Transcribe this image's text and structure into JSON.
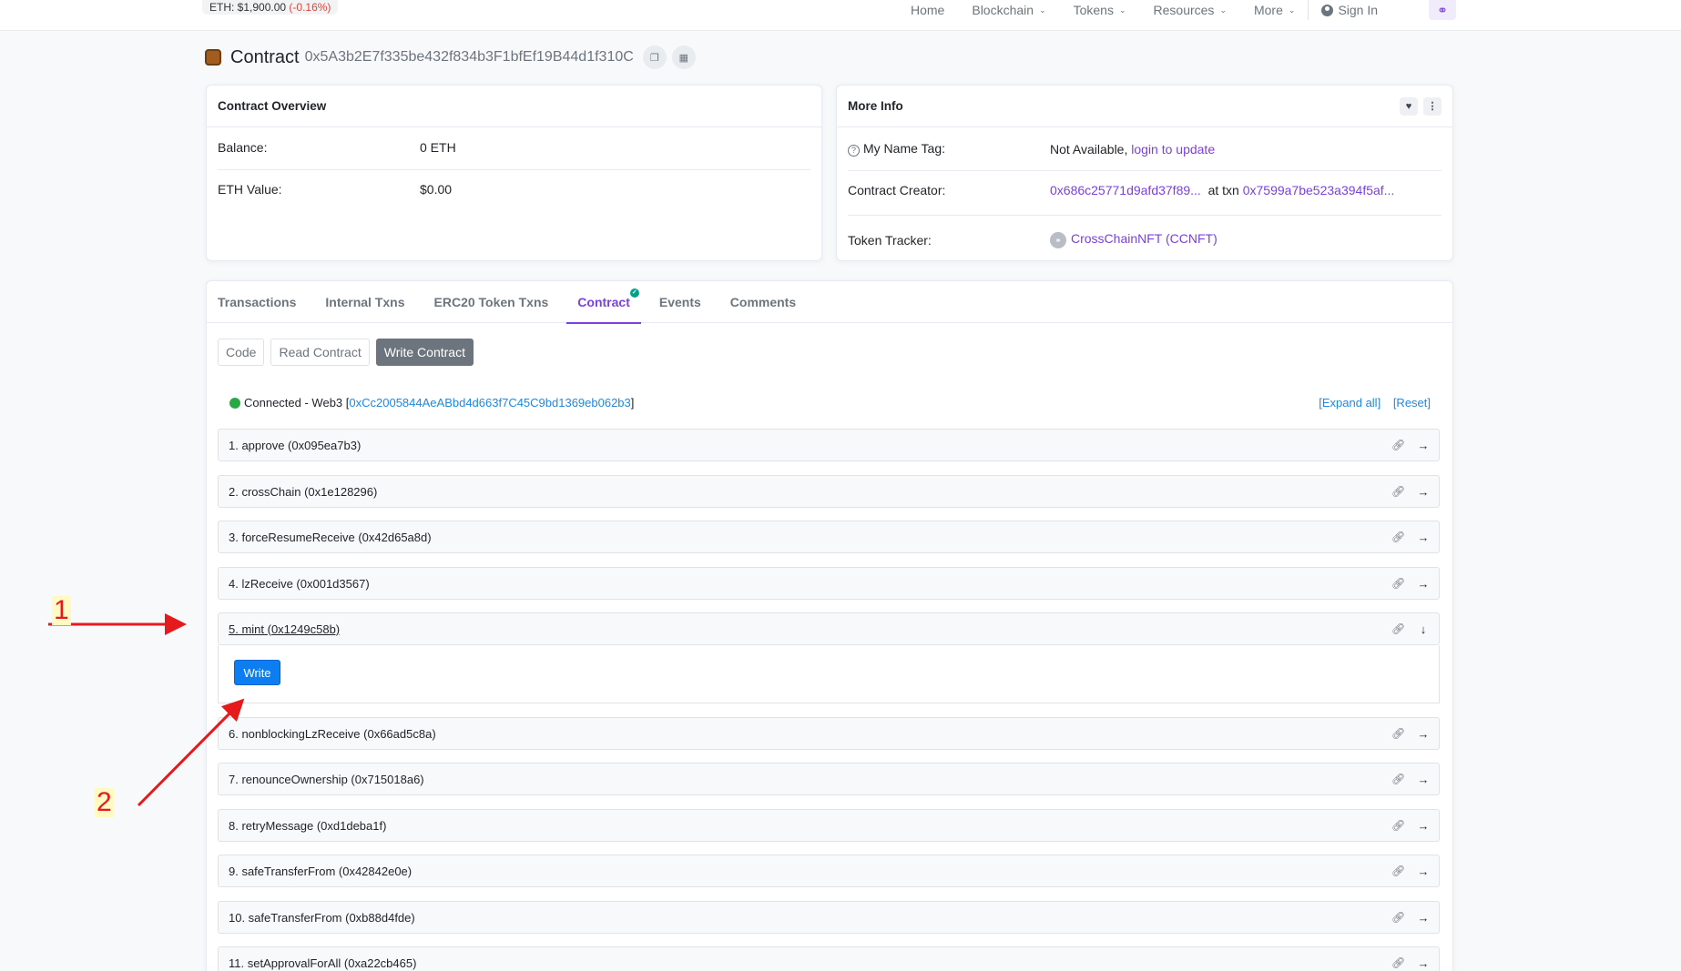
{
  "topbar": {
    "price_label": "ETH: $1,900.00",
    "price_change": "(-0.16%)",
    "nav": [
      {
        "label": "Home",
        "caret": false
      },
      {
        "label": "Blockchain",
        "caret": true
      },
      {
        "label": "Tokens",
        "caret": true
      },
      {
        "label": "Resources",
        "caret": true
      },
      {
        "label": "More",
        "caret": true
      }
    ],
    "sign_in": "Sign In"
  },
  "header": {
    "title": "Contract",
    "address": "0x5A3b2E7f335be432f834b3F1bfEf19B44d1f310C"
  },
  "overview": {
    "title": "Contract Overview",
    "balance_label": "Balance:",
    "balance_value": "0 ETH",
    "eth_value_label": "ETH Value:",
    "eth_value": "$0.00"
  },
  "more_info": {
    "title": "More Info",
    "name_tag_label": "My Name Tag:",
    "name_tag_value": "Not Available,",
    "name_tag_link": "login to update",
    "creator_label": "Contract Creator:",
    "creator_address": "0x686c25771d9afd37f89...",
    "creator_at": "at txn",
    "creator_txn": "0x7599a7be523a394f5af...",
    "token_label": "Token Tracker:",
    "token_value": "CrossChainNFT (CCNFT)"
  },
  "tabs": [
    "Transactions",
    "Internal Txns",
    "ERC20 Token Txns",
    "Contract",
    "Events",
    "Comments"
  ],
  "contract": {
    "sub_buttons": [
      "Code",
      "Read Contract",
      "Write Contract"
    ],
    "connected_text": "Connected - Web3 [",
    "connected_address": "0xCc2005844AeABbd4d663f7C45C9bd1369eb062b3",
    "connected_close": "]",
    "expand_all": "[Expand all]",
    "reset": "[Reset]",
    "write_button": "Write",
    "functions": [
      "1. approve (0x095ea7b3)",
      "2. crossChain (0x1e128296)",
      "3. forceResumeReceive (0x42d65a8d)",
      "4. lzReceive (0x001d3567)",
      "5. mint (0x1249c58b)",
      "6. nonblockingLzReceive (0x66ad5c8a)",
      "7. renounceOwnership (0x715018a6)",
      "8. retryMessage (0xd1deba1f)",
      "9. safeTransferFrom (0x42842e0e)",
      "10. safeTransferFrom (0xb88d4fde)",
      "11. setApprovalForAll (0xa22cb465)"
    ]
  },
  "annotations": {
    "step1": "1",
    "step2": "2"
  },
  "colors": {
    "accent": "#7b3fe4",
    "link_blue": "#1e88e5",
    "write_button": "#0d7ef2",
    "annotation": "#e41a1c"
  }
}
